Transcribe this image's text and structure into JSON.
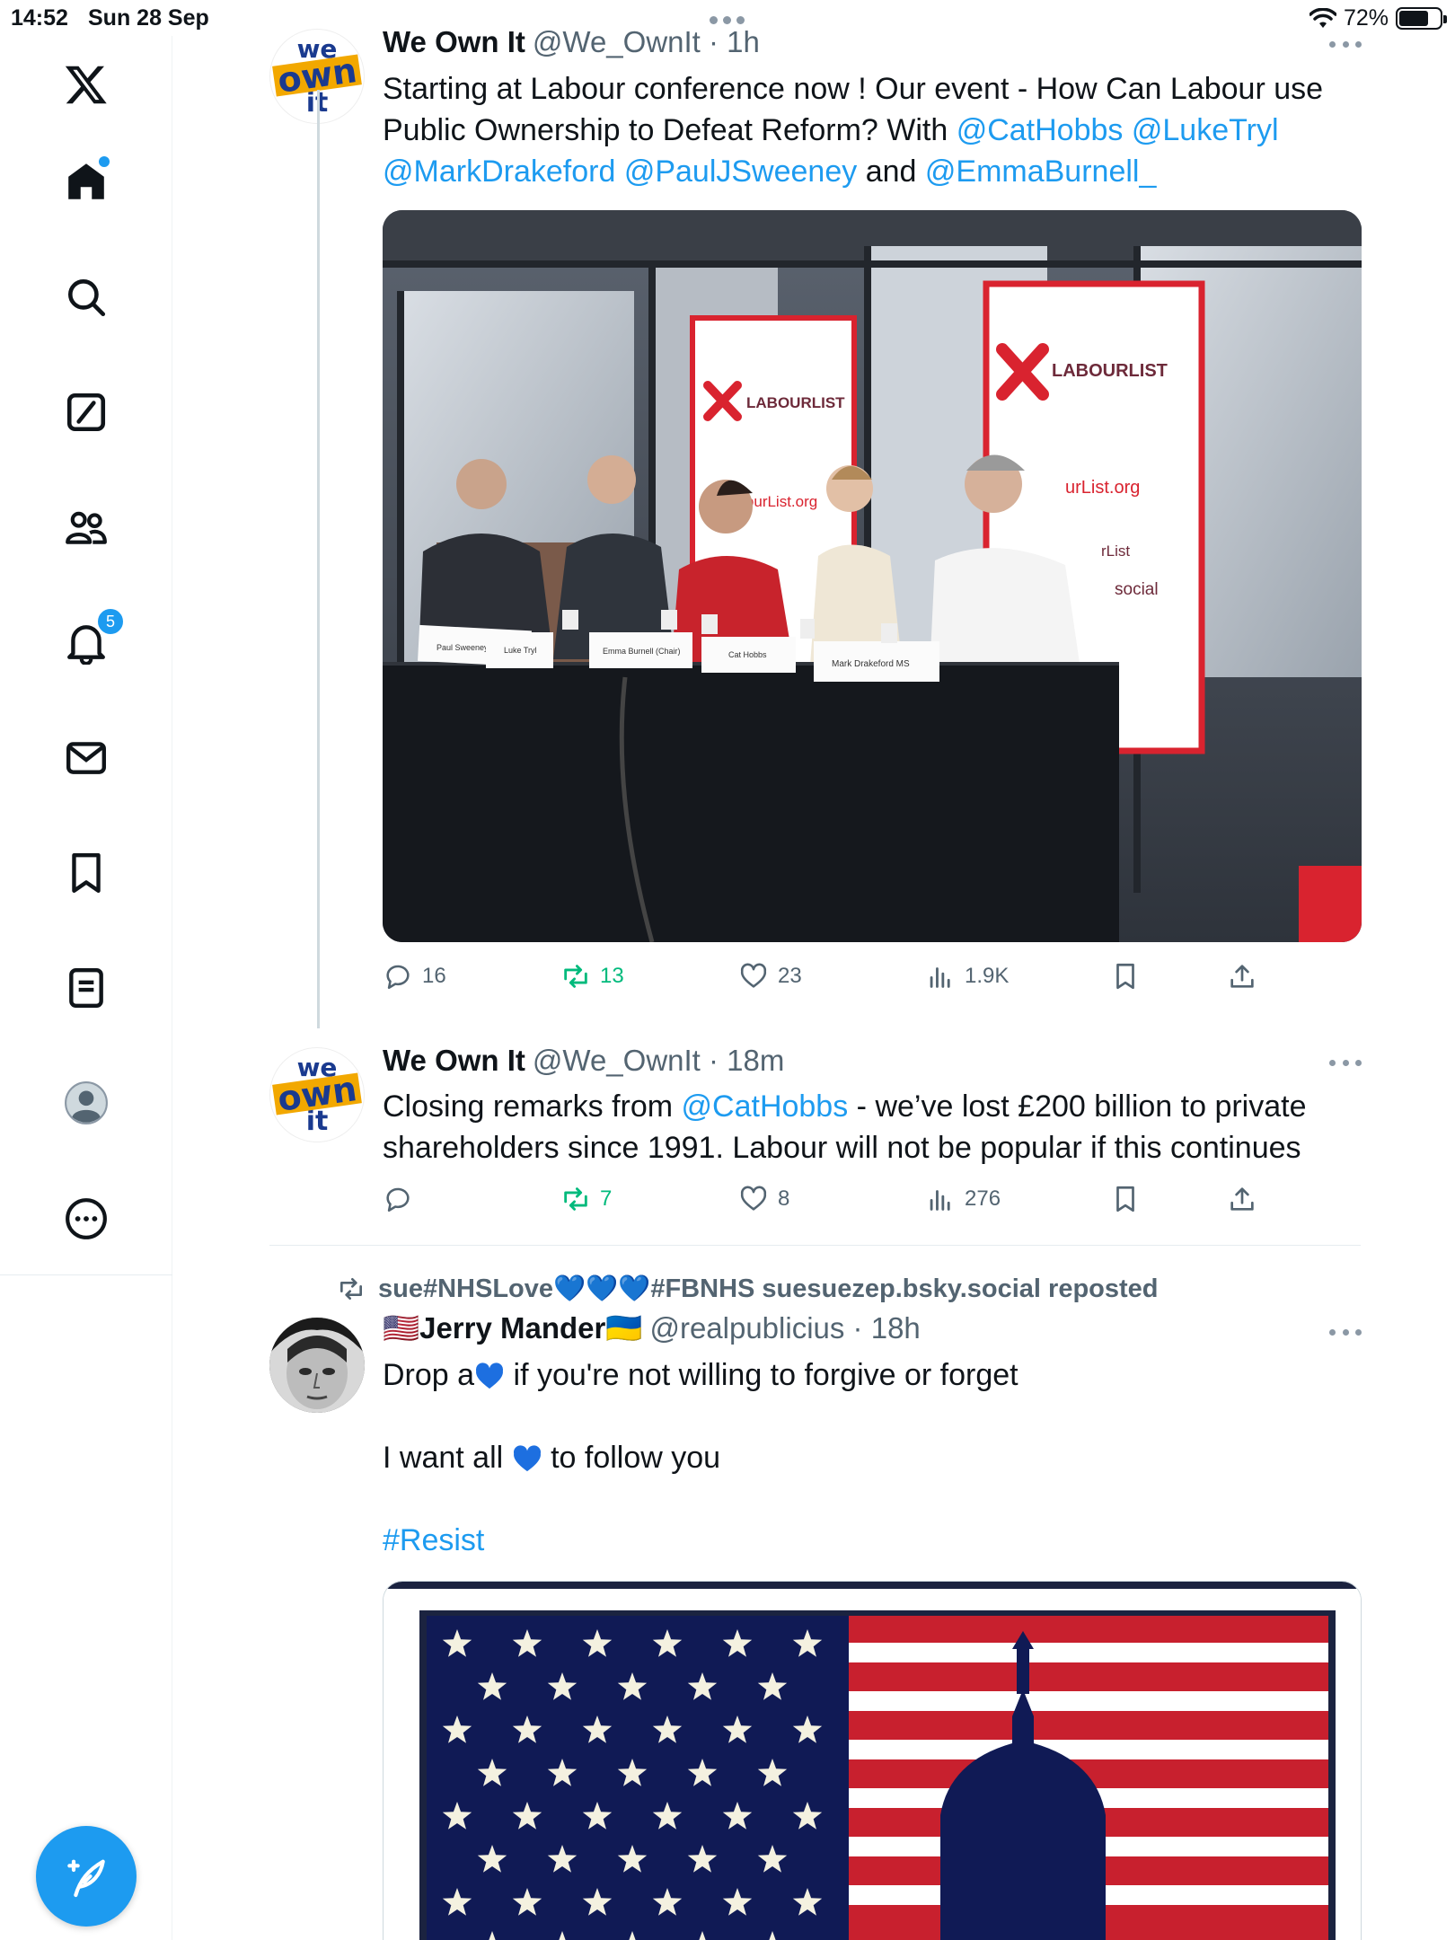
{
  "status": {
    "time": "14:52",
    "date": "Sun 28 Sep",
    "battery": "72%",
    "battery_level": 0.72
  },
  "sidebar": {
    "items": [
      {
        "label": "X",
        "icon": "x-logo-icon"
      },
      {
        "label": "Home",
        "icon": "home-icon"
      },
      {
        "label": "Explore",
        "icon": "search-icon"
      },
      {
        "label": "Grok",
        "icon": "grok-icon"
      },
      {
        "label": "Communities",
        "icon": "communities-icon"
      },
      {
        "label": "Notifications",
        "icon": "bell-icon",
        "badge": "5"
      },
      {
        "label": "Messages",
        "icon": "mail-icon"
      },
      {
        "label": "Bookmarks",
        "icon": "bookmark-icon"
      },
      {
        "label": "Lists",
        "icon": "list-icon"
      },
      {
        "label": "Profile",
        "icon": "profile-icon"
      },
      {
        "label": "More",
        "icon": "more-icon"
      }
    ]
  },
  "tweets": [
    {
      "name": "We Own It",
      "handle": "@We_OwnIt · 1h",
      "text_parts": [
        "Starting at Labour conference now ! Our event - How Can Labour use Public Ownership to Defeat Reform? With ",
        "@CatHobbs",
        " ",
        "@LukeTryl",
        " ",
        "@MarkDrakeford",
        " ",
        "@PaulJSweeney",
        " and ",
        "@EmmaBurnell_"
      ],
      "photo": {
        "banner_brand": "LABOURLIST",
        "banner_url_left": "abourList.org",
        "banner_url_right": "urList.org",
        "banner_extra_1": "rList",
        "banner_extra_2": "social",
        "nameplates": [
          "Paul Sweeney MSP",
          "Luke Tryl",
          "Emma Burnell (Chair)",
          "Cat Hobbs",
          "Mark Drakeford MS"
        ]
      },
      "replies": "16",
      "reposts": "13",
      "likes": "23",
      "views": "1.9K"
    },
    {
      "name": "We Own It",
      "handle": "@We_OwnIt · 18m",
      "text_parts": [
        "Closing remarks from ",
        "@CatHobbs",
        " - we’ve lost £200 billion to private shareholders since 1991. Labour will not be popular if this continues"
      ],
      "replies": "",
      "reposts": "7",
      "likes": "8",
      "views": "276"
    }
  ],
  "repost": {
    "by": "sue#NHSLove💙💙💙#FBNHS suesuezep.bsky.social reposted",
    "name": "Jerry Mander",
    "name_prefix_flag": "🇺🇸",
    "name_suffix_flag": "🇺🇦",
    "handle": "@realpublicius · 18h",
    "line1_a": "Drop a",
    "line1_b": " if you're not willing to forgive or forget",
    "line2_a": "I want all ",
    "line2_b": " to follow you",
    "hashtag": "#Resist"
  },
  "avatar_text": {
    "line1": "we",
    "line2": "own",
    "line3": "it"
  },
  "colors": {
    "accent": "#1d9bf0",
    "repost_green": "#00ba7c",
    "muted": "#536471",
    "heart_blue": "#1d6fe0"
  }
}
